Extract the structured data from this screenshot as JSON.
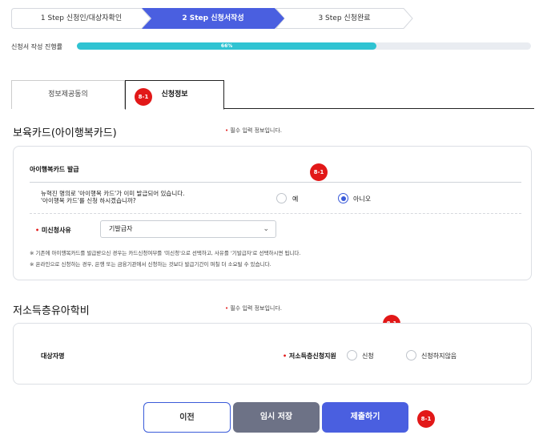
{
  "steps": [
    {
      "label": "1 Step 신청인/대상자확인",
      "state": "done"
    },
    {
      "label": "2 Step 신청서작성",
      "state": "active"
    },
    {
      "label": "3 Step 신청완료",
      "state": "todo"
    }
  ],
  "progress": {
    "label": "신청서 작성 진행률",
    "value_text": "66%",
    "value": 0.66
  },
  "tabs": [
    {
      "label": "정보제공동의",
      "active": false
    },
    {
      "label": "신청정보",
      "active": true,
      "badge": "8-1"
    }
  ],
  "section1": {
    "title": "보육카드(아이행복카드)",
    "required_note": "필수 입력 정보입니다.",
    "card_title": "아이행복카드 발급",
    "badge": "8-1",
    "question_line1": "뉴혁진 명의로 '아이행복 카드'가 이미 발급되어 있습니다.",
    "question_line2": "'아이행복 카드'를 신청 하시겠습니까?",
    "options": [
      {
        "label": "예",
        "checked": false
      },
      {
        "label": "아니오",
        "checked": true
      }
    ],
    "reason_label": "미신청사유",
    "reason_value": "기발급자",
    "notes": [
      "※ 기존에 아이행복카드를 발급받으신 경우는 카드신청여부를 '미신청'으로 선택하고, 사유를 '기발급자'로 선택하시면 됩니다.",
      "※ 온라인으로 신청하는 경우, 은행 또는 금융기관에서 신청하는 것보다 발급기간이 며칠 더 소요될 수 있습니다."
    ]
  },
  "section2": {
    "title": "저소득층유아학비",
    "required_note": "필수 입력 정보입니다.",
    "badge": "8-1",
    "target_label": "대상자명",
    "field_label": "저소득층신청지원",
    "options": [
      {
        "label": "신청",
        "checked": false
      },
      {
        "label": "신청하지않음",
        "checked": false
      }
    ]
  },
  "buttons": {
    "prev": "이전",
    "save": "임시 저장",
    "submit": "제출하기",
    "badge": "8-1"
  },
  "colors": {
    "accent": "#4a5fe0",
    "progress": "#2fc3d2",
    "badge": "#e21818",
    "save_button": "#6d7286"
  }
}
